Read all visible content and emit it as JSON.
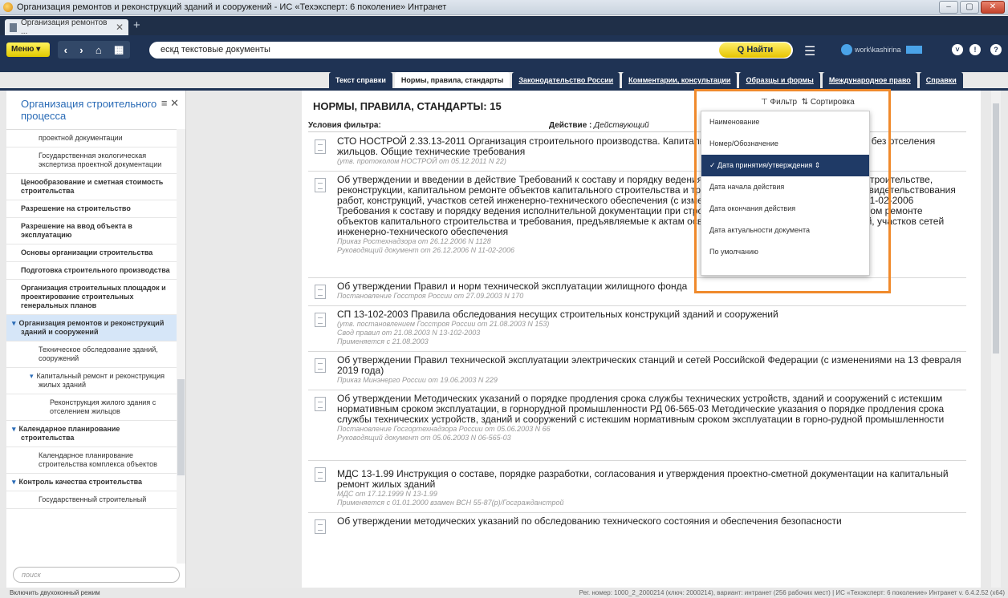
{
  "window": {
    "title": "Организация ремонтов и реконструкций зданий и сооружений - ИС «Техэксперт: 6 поколение» Интранет",
    "controls": [
      "–",
      "▢",
      "✕"
    ]
  },
  "tab": {
    "label": "Организация ремонтов ...",
    "close": "✕",
    "new": "+"
  },
  "toolbar": {
    "menu": "Меню ▾",
    "search_value": "ескд текстовые документы",
    "find": "Q Найти",
    "user": "work\\kashirina"
  },
  "doctabs": [
    "Текст справки",
    "Нормы, правила, стандарты",
    "Законодательство России",
    "Комментарии, консультации",
    "Образцы и формы",
    "Международное право",
    "Справки"
  ],
  "sidebar": {
    "title": "Организация строительного процесса",
    "items": [
      "проектной документации",
      "Государственная экологическая экспертиза проектной документации",
      "Ценообразование и сметная стоимость строительства",
      "Разрешение на строительство",
      "Разрешение на ввод объекта в эксплуатацию",
      "Основы организации строительства",
      "Подготовка строительного производства",
      "Организация строительных площадок и проектирование строительных генеральных планов",
      "Организация ремонтов и реконструкций зданий и сооружений",
      "Техническое обследование зданий, сооружений",
      "Капитальный ремонт и реконструкция жилых зданий",
      "Реконструкция жилого здания с отселением жильцов",
      "Календарное планирование строительства",
      "Календарное планирование строительства комплекса объектов",
      "Контроль качества строительства",
      "Государственный строительный"
    ],
    "search_placeholder": "поиск"
  },
  "main": {
    "title": "НОРМЫ, ПРАВИЛА, СТАНДАРТЫ: 15",
    "filter": "Фильтр",
    "sort": "Сортировка",
    "cond_label": "Условия фильтра:",
    "action_label": "Действие :",
    "action_value": "Действующий",
    "docs": [
      {
        "t": "СТО НОСТРОЙ 2.33.13-2011 Организация строительного производства. Капитальный ремонт многоквартирных домов без отселения жильцов. Общие технические требования",
        "m": [
          "(утв. протоколом НОСТРОЙ от 05.12.2011 N 22)"
        ]
      },
      {
        "t": "Об утверждении и введении в действие Требований к составу и порядку ведения исполнительной документации при строительстве, реконструкции, капитальном ремонте объектов капитального строительства и требований, предъявляемых к актам освидетельствования работ, конструкций, участков сетей инженерно-технического обеспечения (с изменениями на 9 ноября 2017 года) РД-11-02-2006 Требования к составу и порядку ведения исполнительной документации при строительстве, реконструкции, капитальном ремонте объектов капитального строительства и требования, предъявляемые к актам освидетельствования работ, конструкций, участков сетей инженерно-технического обеспечения",
        "m": [
          "Приказ Ростехнадзора от 26.12.2006 N 1128",
          "Руководящий документ от 26.12.2006 N 11-02-2006"
        ]
      },
      {
        "t": "Об утверждении Правил и норм технической эксплуатации жилищного фонда",
        "m": [
          "Постановление Госстроя России от 27.09.2003 N 170"
        ]
      },
      {
        "t": "СП 13-102-2003 Правила обследования несущих строительных конструкций зданий и сооружений",
        "m": [
          "(утв. постановлением Госстроя России от 21.08.2003 N 153)",
          "Свод правил от 21.08.2003 N 13-102-2003",
          "Применяется с 21.08.2003"
        ]
      },
      {
        "t": "Об утверждении Правил технической эксплуатации электрических станций и сетей Российской Федерации (с изменениями на 13 февраля 2019 года)",
        "m": [
          "Приказ Минэнерго России от 19.06.2003 N 229"
        ]
      },
      {
        "t": "Об утверждении Методических указаний о порядке продления срока службы технических устройств, зданий и сооружений с истекшим нормативным сроком эксплуатации, в горнорудной промышленности РД 06-565-03 Методические указания о порядке продления срока службы технических устройств, зданий и сооружений с истекшим нормативным сроком эксплуатации в горно-рудной промышленности",
        "m": [
          "Постановление Госгортехнадзора России от 05.06.2003 N 66",
          "Руководящий документ от 05.06.2003 N 06-565-03"
        ]
      },
      {
        "t": "МДС 13-1.99 Инструкция о составе, порядке разработки, согласования и утверждения проектно-сметной документации на капитальный ремонт жилых зданий",
        "m": [
          "МДС от 17.12.1999 N 13-1.99",
          "Применяется с 01.01.2000 взамен ВСН 55-87(р)/Госгражданстрой"
        ]
      },
      {
        "t": "Об утверждении методических указаний по обследованию технического состояния и обеспечения безопасности",
        "m": []
      }
    ]
  },
  "sort_menu": {
    "items": [
      "Наименование",
      "Номер/Обозначение",
      "✓ Дата принятия/утверждения ⇕",
      "Дата начала действия",
      "Дата окончания действия",
      "Дата актуальности документа",
      "По умолчанию"
    ],
    "selected_index": 2
  },
  "statusbar": {
    "left": "Включить двухоконный режим",
    "right": "Рег. номер: 1000_2_2000214 (ключ: 2000214), вариант: интранет (256 рабочих мест)   |   ИС «Техэксперт: 6 поколение» Интранет v. 6.4.2.52 (x64)"
  }
}
